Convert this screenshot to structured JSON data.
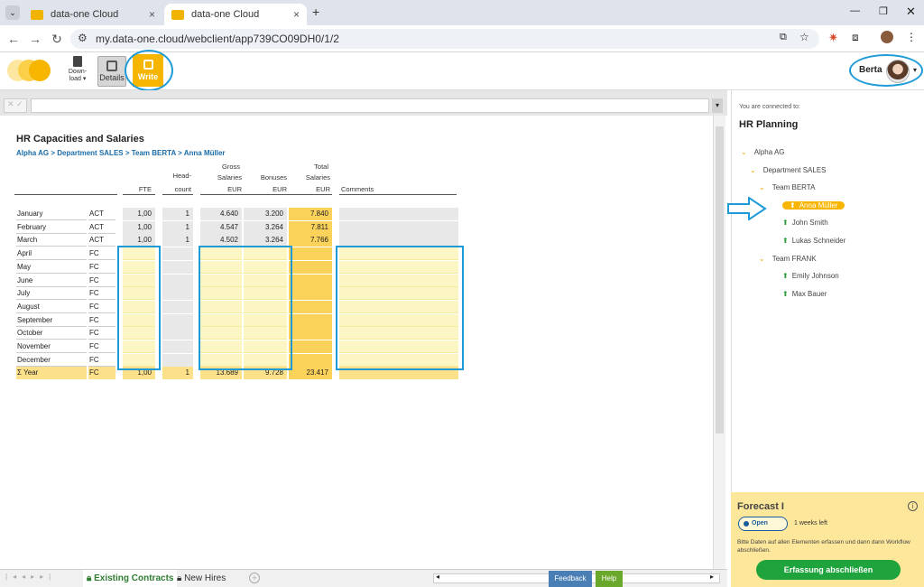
{
  "browser": {
    "tabs": [
      {
        "label": "data-one Cloud",
        "active": false
      },
      {
        "label": "data-one Cloud",
        "active": true
      }
    ],
    "url": "my.data-one.cloud/webclient/app739CO09DH0/1/2",
    "new_tab_glyph": "+"
  },
  "toolbar": {
    "download_label_1": "Down-",
    "download_label_2": "load",
    "details_label": "Details",
    "write_label": "Write",
    "user_name": "Berta"
  },
  "sheet": {
    "title": "HR Capacities and Salaries",
    "breadcrumb": "Alpha AG > Department SALES > Team BERTA > Anna Müller",
    "headers": {
      "fte": "FTE",
      "head1": "Head-",
      "head2": "count",
      "gross1": "Gross",
      "gross2": "Salaries",
      "gross3": "EUR",
      "bonuses": "Bonuses",
      "bonuses_unit": "EUR",
      "total1": "Total",
      "total2": "Salaries",
      "total3": "EUR",
      "comments": "Comments"
    },
    "rows": [
      {
        "month": "January",
        "type": "ACT",
        "fte": "1,00",
        "head": "1",
        "gross": "4.640",
        "bonus": "3.200",
        "total": "7.840"
      },
      {
        "month": "February",
        "type": "ACT",
        "fte": "1,00",
        "head": "1",
        "gross": "4.547",
        "bonus": "3.264",
        "total": "7.811"
      },
      {
        "month": "March",
        "type": "ACT",
        "fte": "1,00",
        "head": "1",
        "gross": "4.502",
        "bonus": "3.264",
        "total": "7.766"
      },
      {
        "month": "April",
        "type": "FC",
        "fte": "",
        "head": "",
        "gross": "",
        "bonus": "",
        "total": ""
      },
      {
        "month": "May",
        "type": "FC",
        "fte": "",
        "head": "",
        "gross": "",
        "bonus": "",
        "total": ""
      },
      {
        "month": "June",
        "type": "FC",
        "fte": "",
        "head": "",
        "gross": "",
        "bonus": "",
        "total": ""
      },
      {
        "month": "July",
        "type": "FC",
        "fte": "",
        "head": "",
        "gross": "",
        "bonus": "",
        "total": ""
      },
      {
        "month": "August",
        "type": "FC",
        "fte": "",
        "head": "",
        "gross": "",
        "bonus": "",
        "total": ""
      },
      {
        "month": "September",
        "type": "FC",
        "fte": "",
        "head": "",
        "gross": "",
        "bonus": "",
        "total": ""
      },
      {
        "month": "October",
        "type": "FC",
        "fte": "",
        "head": "",
        "gross": "",
        "bonus": "",
        "total": ""
      },
      {
        "month": "November",
        "type": "FC",
        "fte": "",
        "head": "",
        "gross": "",
        "bonus": "",
        "total": ""
      },
      {
        "month": "December",
        "type": "FC",
        "fte": "",
        "head": "",
        "gross": "",
        "bonus": "",
        "total": ""
      }
    ],
    "year_row": {
      "month": "Σ Year",
      "type": "FC",
      "fte": "1,00",
      "head": "1",
      "gross": "13.689",
      "bonus": "9.728",
      "total": "23.417"
    }
  },
  "sheet_tabs": {
    "existing": "Existing Contracts",
    "new_hires": "New Hires",
    "feedback": "Feedback",
    "help": "Help"
  },
  "panel": {
    "connected": "You are connected to:",
    "title": "HR Planning",
    "tree": [
      {
        "label": "Alpha AG",
        "kind": "node",
        "level": 0
      },
      {
        "label": "Department SALES",
        "kind": "node",
        "level": 1
      },
      {
        "label": "Team BERTA",
        "kind": "node",
        "level": 2
      },
      {
        "label": "Anna Müller",
        "kind": "person",
        "level": 3,
        "selected": true
      },
      {
        "label": "John Smith",
        "kind": "person",
        "level": 3
      },
      {
        "label": "Lukas Schneider",
        "kind": "person",
        "level": 3
      },
      {
        "label": "Team FRANK",
        "kind": "node",
        "level": 2
      },
      {
        "label": "Emily Johnson",
        "kind": "person",
        "level": 3
      },
      {
        "label": "Max Bauer",
        "kind": "person",
        "level": 3
      }
    ]
  },
  "forecast": {
    "title": "Forecast I",
    "status": "Open",
    "weeks": "1 weeks left",
    "description": "Bitte Daten auf allen Elementen erfassen und dann dann Workflow abschließen.",
    "button": "Erfassung abschließen"
  },
  "colors": {
    "accent": "#f6b600",
    "highlight": "#1e9bd7",
    "green": "#1fa33c"
  }
}
